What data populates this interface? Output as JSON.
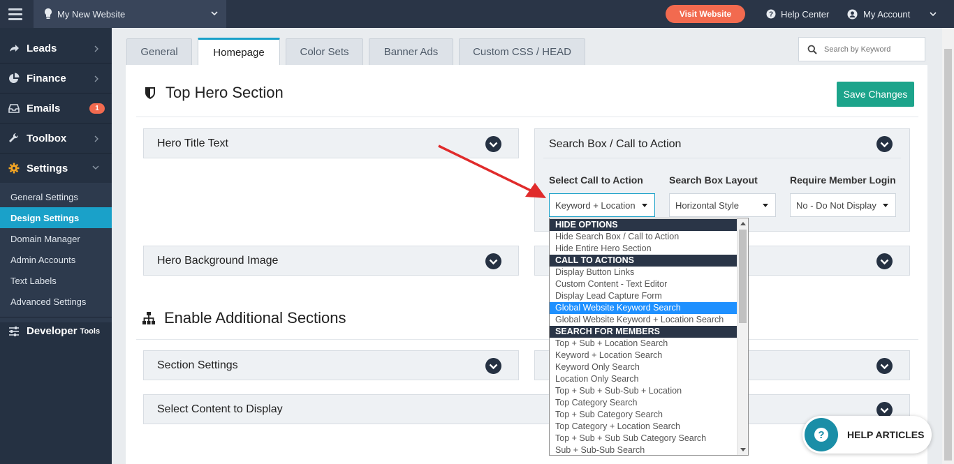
{
  "topbar": {
    "site_name": "My New Website",
    "visit_button": "Visit Website",
    "help_center": "Help Center",
    "my_account": "My Account"
  },
  "sidebar": {
    "items": [
      {
        "label": "Leads",
        "icon": "arrow-right-icon"
      },
      {
        "label": "Finance",
        "icon": "pie-chart-icon"
      },
      {
        "label": "Emails",
        "icon": "inbox-icon",
        "badge": "1"
      },
      {
        "label": "Toolbox",
        "icon": "wrench-icon"
      },
      {
        "label": "Settings",
        "icon": "gear-icon"
      }
    ],
    "sub_items": [
      "General Settings",
      "Design Settings",
      "Domain Manager",
      "Admin Accounts",
      "Text Labels",
      "Advanced Settings"
    ],
    "developer": {
      "label": "Developer",
      "suffix": "Tools"
    }
  },
  "tabs": [
    "General",
    "Homepage",
    "Color Sets",
    "Banner Ads",
    "Custom CSS / HEAD"
  ],
  "search": {
    "placeholder": "Search by Keyword"
  },
  "content": {
    "hero_title": "Top Hero Section",
    "save_button": "Save Changes",
    "hero_title_text": "Hero Title Text",
    "hero_background": "Hero Background Image",
    "additional_title": "Enable Additional Sections",
    "section_settings": "Section Settings",
    "select_content": "Select Content to Display",
    "search_panel": {
      "title": "Search Box / Call to Action",
      "labels": [
        "Select Call to Action",
        "Search Box Layout",
        "Require Member Login"
      ],
      "values": [
        "Keyword + Location",
        "Horizontal Style",
        "No - Do Not Display"
      ]
    }
  },
  "dropdown": {
    "options": [
      {
        "label": "HIDE OPTIONS",
        "group": true
      },
      {
        "label": "Hide Search Box / Call to Action"
      },
      {
        "label": "Hide Entire Hero Section"
      },
      {
        "label": "CALL TO ACTIONS",
        "group": true
      },
      {
        "label": "Display Button Links"
      },
      {
        "label": "Custom Content - Text Editor"
      },
      {
        "label": "Display Lead Capture Form"
      },
      {
        "label": "Global Website Keyword Search",
        "highlighted": true
      },
      {
        "label": "Global Website Keyword + Location Search"
      },
      {
        "label": "SEARCH FOR MEMBERS",
        "group": true
      },
      {
        "label": "Top + Sub + Location Search"
      },
      {
        "label": "Keyword + Location Search"
      },
      {
        "label": "Keyword Only Search"
      },
      {
        "label": "Location Only Search"
      },
      {
        "label": "Top + Sub + Sub-Sub + Location"
      },
      {
        "label": "Top Category Search"
      },
      {
        "label": "Top + Sub Category Search"
      },
      {
        "label": "Top Category + Location Search"
      },
      {
        "label": "Top + Sub + Sub Sub Category Search"
      },
      {
        "label": "Sub + Sub-Sub Search"
      }
    ]
  },
  "help_articles": "HELP ARTICLES",
  "colors": {
    "accent": "#1aa1c9",
    "save": "#1ca48b",
    "visit": "#f26a4f",
    "nav": "#253142"
  }
}
